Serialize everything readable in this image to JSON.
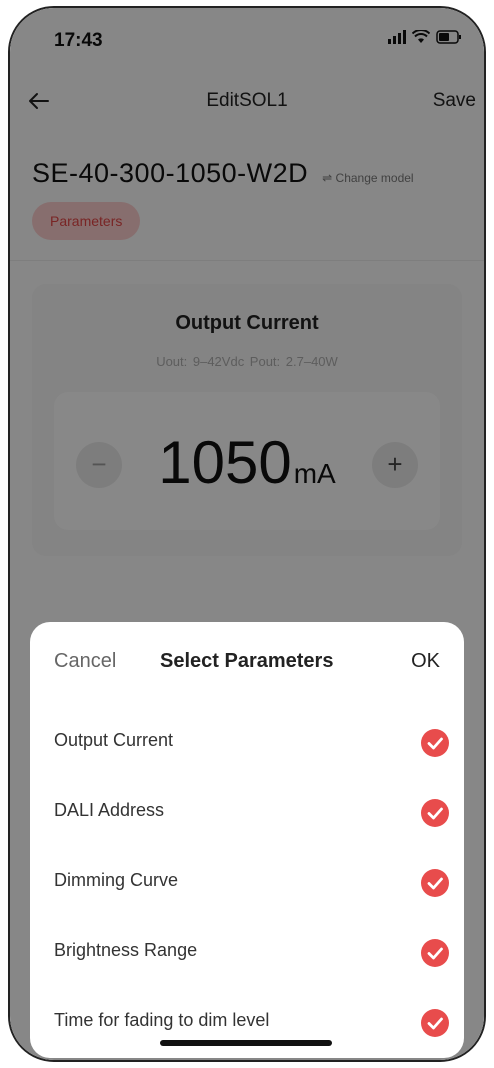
{
  "status": {
    "time": "17:43"
  },
  "nav": {
    "title": "EditSOL1",
    "save_label": "Save"
  },
  "model": {
    "name": "SE-40-300-1050-W2D",
    "change_label": "⇌ Change model"
  },
  "chip": {
    "label": "Parameters"
  },
  "card": {
    "title": "Output Current",
    "subtitle": "Uout: 9–42Vdc   Pout: 2.7–40W",
    "value": "1050",
    "unit": "mA",
    "minus_label": "−",
    "plus_label": "+"
  },
  "sheet": {
    "cancel_label": "Cancel",
    "title": "Select Parameters",
    "ok_label": "OK",
    "items": [
      {
        "label": "Output Current",
        "checked": true
      },
      {
        "label": "DALI Address",
        "checked": true
      },
      {
        "label": "Dimming Curve",
        "checked": true
      },
      {
        "label": "Brightness Range",
        "checked": true
      },
      {
        "label": "Time for fading to dim level",
        "checked": true
      }
    ]
  },
  "colors": {
    "accent": "#e84c4c",
    "chip_bg": "#f6c9c9"
  }
}
